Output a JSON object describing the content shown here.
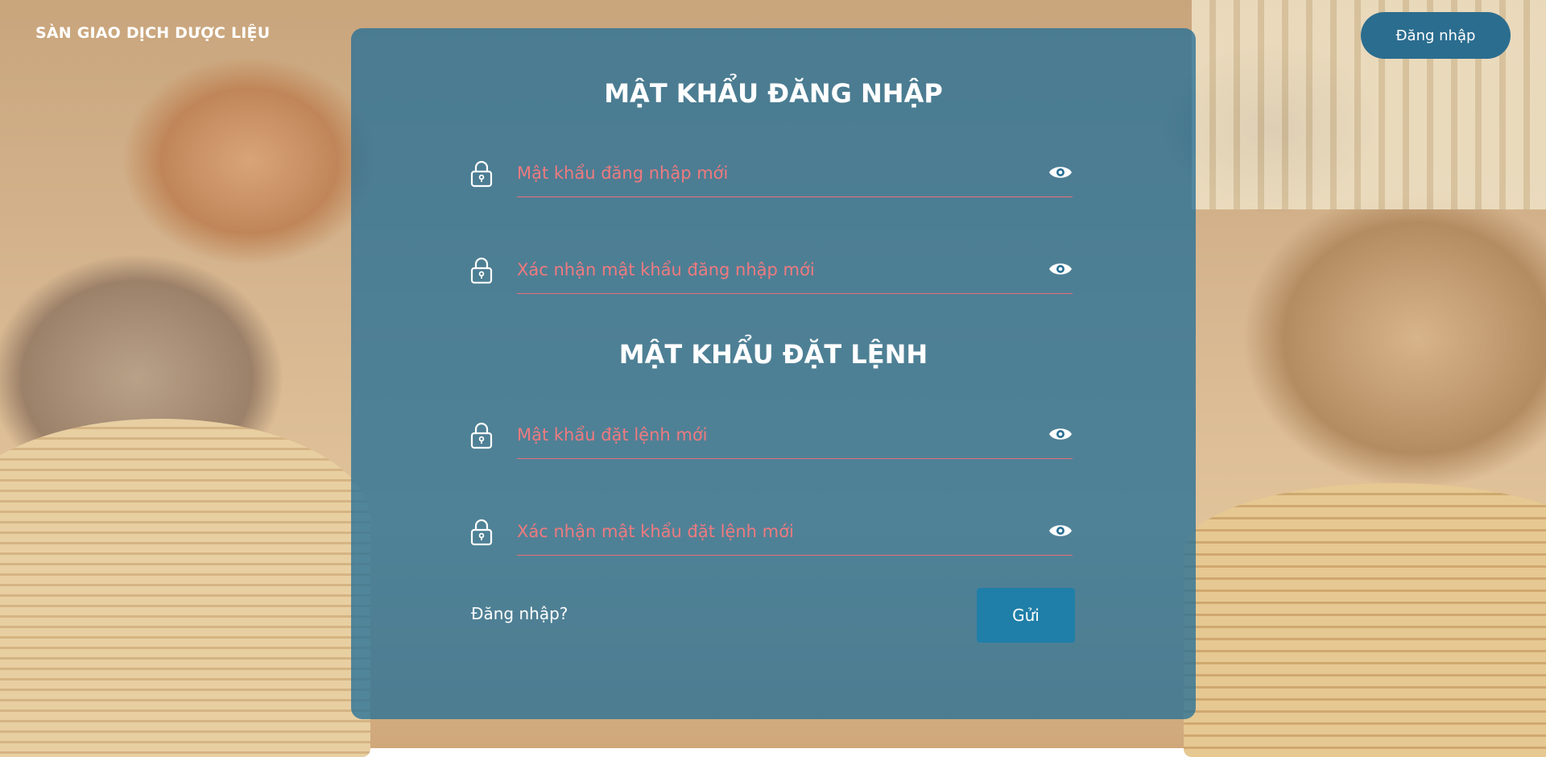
{
  "header": {
    "brand": "SÀN GIAO DỊCH DƯỢC LIỆU",
    "login_button": "Đăng nhập"
  },
  "login_password": {
    "title": "MẬT KHẨU ĐĂNG NHẬP",
    "new_placeholder": "Mật khẩu đăng nhập mới",
    "confirm_placeholder": "Xác nhận mật khẩu đăng nhập mới"
  },
  "order_password": {
    "title": "MẬT KHẨU ĐẶT LỆNH",
    "new_placeholder": "Mật khẩu đặt lệnh mới",
    "confirm_placeholder": "Xác nhận mật khẩu đặt lệnh mới"
  },
  "footer": {
    "login_link": "Đăng nhập?",
    "submit_button": "Gửi"
  },
  "colors": {
    "panel": "#26709699",
    "header_button": "#2b6d8f",
    "submit_button": "#1f7fa8",
    "placeholder": "#ef7a7f",
    "underline": "#e86f76"
  },
  "icons": [
    "lock-icon",
    "eye-icon"
  ]
}
